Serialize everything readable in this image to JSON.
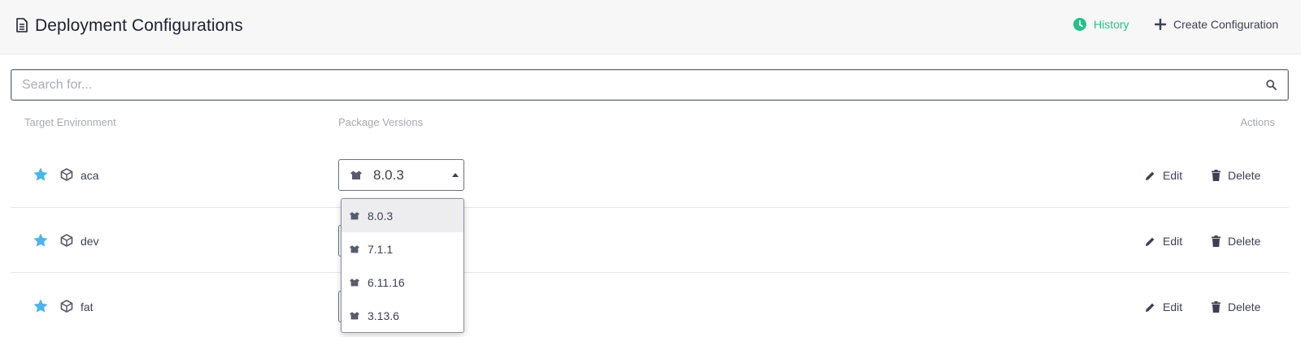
{
  "header": {
    "title": "Deployment Configurations",
    "history_label": "History",
    "create_label": "Create Configuration"
  },
  "search": {
    "placeholder": "Search for..."
  },
  "columns": {
    "target": "Target Environment",
    "packages": "Package Versions",
    "actions": "Actions"
  },
  "rows": [
    {
      "env": "aca",
      "selected_version": "8.0.3",
      "edit": "Edit",
      "delete": "Delete"
    },
    {
      "env": "dev",
      "edit": "Edit",
      "delete": "Delete"
    },
    {
      "env": "fat",
      "edit": "Edit",
      "delete": "Delete"
    }
  ],
  "version_options": [
    "8.0.3",
    "7.1.1",
    "6.11.16",
    "3.13.6"
  ],
  "colors": {
    "accent_green": "#27c08a",
    "star_blue": "#4fb3e8",
    "text": "#3d3f52",
    "muted": "#a7a9b3"
  }
}
